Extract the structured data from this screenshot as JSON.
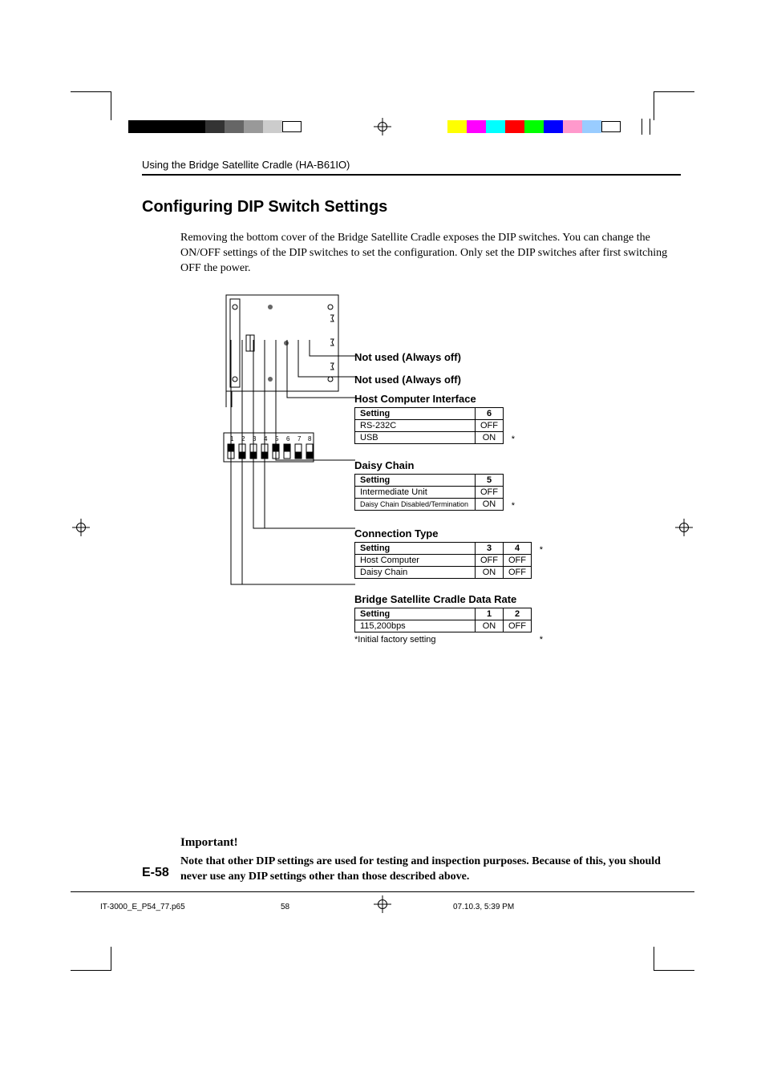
{
  "running_head": "Using the Bridge Satellite Cradle (HA-B61IO)",
  "h1": "Configuring DIP Switch Settings",
  "intro": "Removing the bottom cover of the Bridge Satellite Cradle exposes the DIP switches. You can change the ON/OFF settings of the DIP switches to set the configuration. Only set the DIP switches after first switching OFF the power.",
  "dip_labels": [
    "1",
    "2",
    "3",
    "4",
    "5",
    "6",
    "7",
    "8"
  ],
  "sections": {
    "sw8": {
      "label": "Not used (Always off)"
    },
    "sw7": {
      "label": "Not used (Always off)"
    },
    "host_if": {
      "title": "Host Computer Interface",
      "head": [
        "Setting",
        "6"
      ],
      "rows": [
        {
          "cells": [
            "RS-232C",
            "OFF"
          ],
          "star": false
        },
        {
          "cells": [
            "USB",
            "ON"
          ],
          "star": true
        }
      ]
    },
    "daisy": {
      "title": "Daisy Chain",
      "head": [
        "Setting",
        "5"
      ],
      "rows": [
        {
          "cells": [
            "Intermediate Unit",
            "OFF"
          ],
          "star": false
        },
        {
          "cells": [
            "Daisy Chain Disabled/Termination",
            "ON"
          ],
          "star": true
        }
      ]
    },
    "conn": {
      "title": "Connection Type",
      "head": [
        "Setting",
        "3",
        "4"
      ],
      "rows": [
        {
          "cells": [
            "Host Computer",
            "OFF",
            "OFF"
          ],
          "star": true
        },
        {
          "cells": [
            "Daisy Chain",
            "ON",
            "OFF"
          ],
          "star": false
        }
      ]
    },
    "rate": {
      "title": "Bridge Satellite Cradle Data Rate",
      "head": [
        "Setting",
        "1",
        "2"
      ],
      "rows": [
        {
          "cells": [
            "115,200bps",
            "ON",
            "OFF"
          ],
          "star": true
        }
      ]
    }
  },
  "footnote": "*Initial factory setting",
  "important_head": "Important!",
  "important_body": "Note that other DIP settings are used for testing and inspection purposes. Because of this, you should never use any DIP settings other than those described above.",
  "page_num": "E-58",
  "footer": {
    "file": "IT-3000_E_P54_77.p65",
    "page": "58",
    "date": "07.10.3, 5:39 PM"
  }
}
